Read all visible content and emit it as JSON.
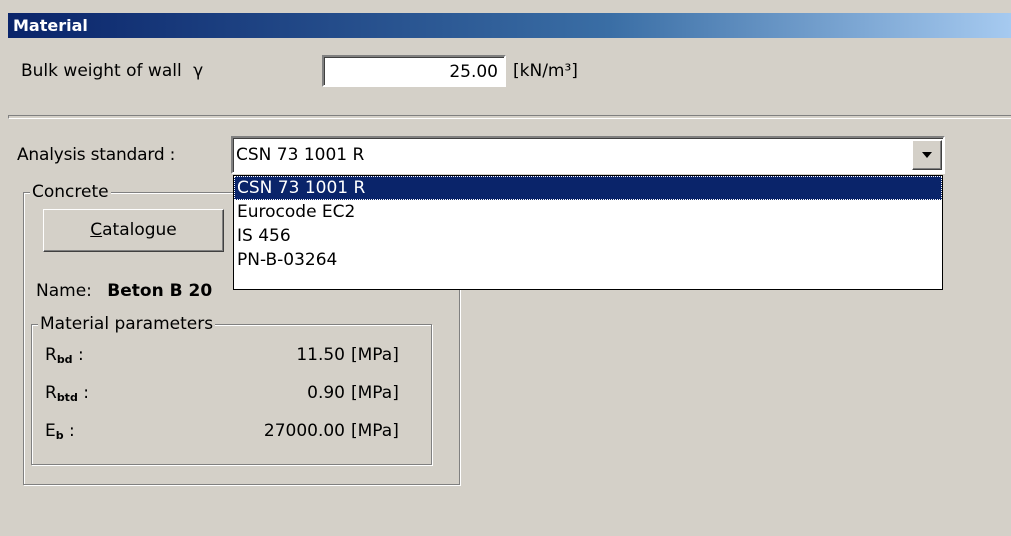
{
  "window": {
    "title": "Material"
  },
  "bulk_weight": {
    "label": "Bulk weight of wall",
    "symbol": "γ",
    "value": "25.00",
    "unit": "[kN/m³]"
  },
  "analysis_standard": {
    "label": "Analysis standard :",
    "selected": "CSN 73 1001 R",
    "options": [
      "CSN 73 1001 R",
      "Eurocode EC2",
      "IS 456",
      "PN-B-03264"
    ]
  },
  "concrete": {
    "group_label": "Concrete",
    "catalogue_button": "Catalogue",
    "name_label": "Name:",
    "name_value": "Beton B 20",
    "params_group_label": "Material parameters",
    "params": [
      {
        "symbol": "R",
        "sub": "bd",
        "value": "11.50",
        "unit": "[MPa]"
      },
      {
        "symbol": "R",
        "sub": "btd",
        "value": "0.90",
        "unit": "[MPa]"
      },
      {
        "symbol": "E",
        "sub": "b",
        "value": "27000.00",
        "unit": "[MPa]"
      }
    ]
  },
  "colors": {
    "titlebar_start": "#0a246a",
    "titlebar_end": "#a6caf0",
    "background": "#d4d0c8",
    "selection": "#0a246a"
  }
}
